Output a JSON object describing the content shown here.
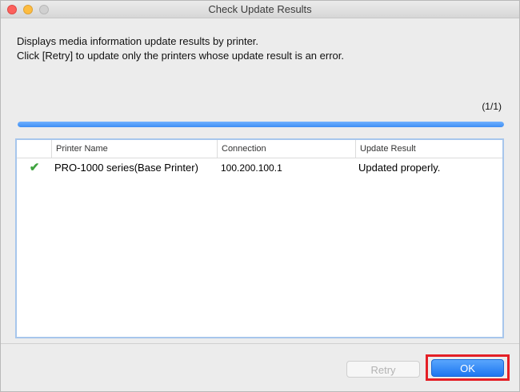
{
  "window": {
    "title": "Check Update Results"
  },
  "description": {
    "line1": "Displays media information update results by printer.",
    "line2": "Click [Retry] to update only the printers whose update result is an error."
  },
  "progress": {
    "counter": "(1/1)",
    "fraction": 1.0
  },
  "table": {
    "columns": [
      "",
      "Printer Name",
      "Connection",
      "Update Result"
    ],
    "rows": [
      {
        "status_icon": "checkmark-icon",
        "status_glyph": "✔",
        "printer_name": "PRO-1000 series(Base Printer)",
        "connection": "100.200.100.1",
        "update_result": "Updated properly."
      }
    ]
  },
  "buttons": {
    "retry": "Retry",
    "ok": "OK"
  },
  "colors": {
    "accent": "#3e8ff4",
    "highlight": "#e41f26",
    "success": "#3fa33f"
  }
}
